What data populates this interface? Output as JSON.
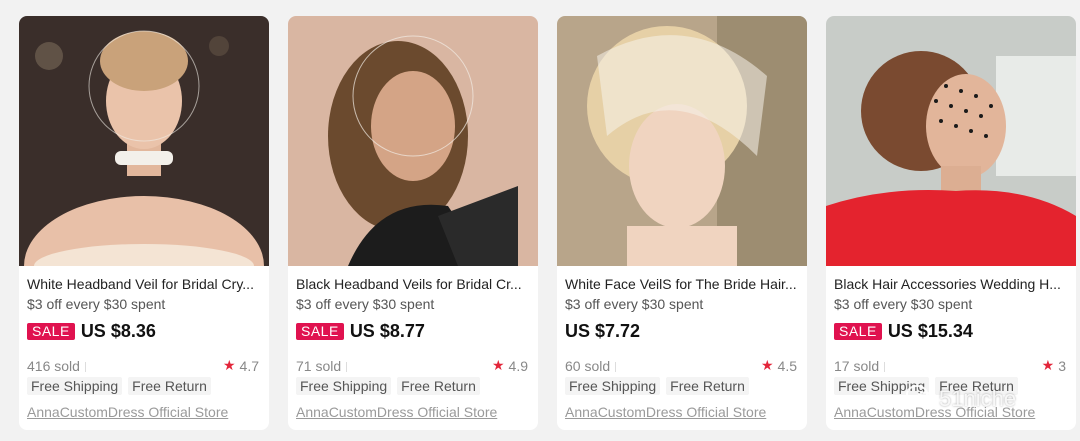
{
  "products": [
    {
      "title": "White Headband Veil for Bridal Cry...",
      "promo": "$3 off every $30 spent",
      "sale_badge": "SALE",
      "price": "US $8.36",
      "sold": "416 sold",
      "rating": "4.7",
      "tags": [
        "Free Shipping",
        "Free Return"
      ],
      "store": "AnnaCustomDress Official Store"
    },
    {
      "title": "Black Headband Veils for Bridal Cr...",
      "promo": "$3 off every $30 spent",
      "sale_badge": "SALE",
      "price": "US $8.77",
      "sold": "71 sold",
      "rating": "4.9",
      "tags": [
        "Free Shipping",
        "Free Return"
      ],
      "store": "AnnaCustomDress Official Store"
    },
    {
      "title": "White Face VeilS for The Bride Hair...",
      "promo": "$3 off every $30 spent",
      "sale_badge": "",
      "price": "US $7.72",
      "sold": "60 sold",
      "rating": "4.5",
      "tags": [
        "Free Shipping",
        "Free Return"
      ],
      "store": "AnnaCustomDress Official Store"
    },
    {
      "title": "Black Hair Accessories Wedding H...",
      "promo": "$3 off every $30 spent",
      "sale_badge": "SALE",
      "price": "US $15.34",
      "sold": "17 sold",
      "rating": "3",
      "tags": [
        "Free Shipping",
        "Free Return"
      ],
      "store": "AnnaCustomDress Official Store"
    }
  ],
  "watermark": "51niche",
  "colors": {
    "sale": "#e0124f",
    "star": "#e3253a",
    "card_bg": "#ffffff",
    "page_bg": "#f2f2f2"
  },
  "icons": {
    "rating": "star-icon",
    "watermark": "wechat-icon"
  }
}
